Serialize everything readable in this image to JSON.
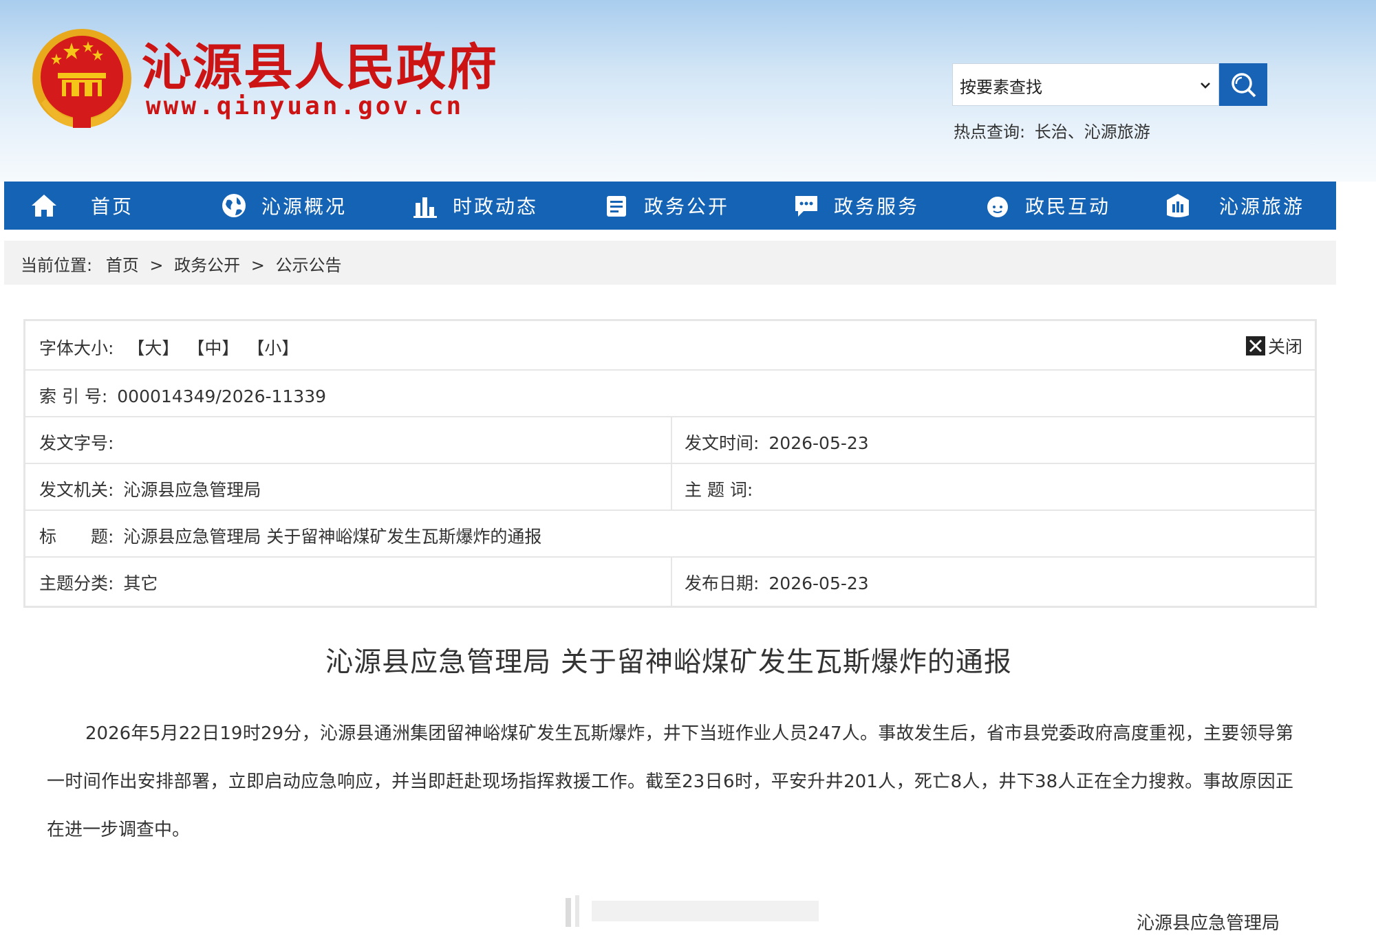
{
  "header": {
    "site_name": "沁源县人民政府",
    "site_url": "www.qinyuan.gov.cn",
    "search": {
      "selected": "按要素查找",
      "button_icon": "search-icon"
    },
    "hot_search": {
      "label": "热点查询:",
      "terms": "长治、沁源旅游"
    }
  },
  "nav": {
    "items": [
      {
        "label": "首页",
        "icon": "home-icon"
      },
      {
        "label": "沁源概况",
        "icon": "globe-icon"
      },
      {
        "label": "时政动态",
        "icon": "bar-chart-icon"
      },
      {
        "label": "政务公开",
        "icon": "document-icon"
      },
      {
        "label": "政务服务",
        "icon": "chat-icon"
      },
      {
        "label": "政民互动",
        "icon": "people-icon"
      },
      {
        "label": "沁源旅游",
        "icon": "building-icon"
      }
    ]
  },
  "breadcrumb": {
    "prefix": "当前位置:",
    "items": [
      "首页",
      "政务公开",
      "公示公告"
    ],
    "separator": ">"
  },
  "info_table": {
    "font_size": {
      "label": "字体大小:",
      "large": "【大】",
      "medium": "【中】",
      "small": "【小】"
    },
    "close_label": "关闭",
    "index_no": {
      "label": "索 引 号:",
      "value": "000014349/2026-11339"
    },
    "doc_no": {
      "label": "发文字号:",
      "value": ""
    },
    "issue_time": {
      "label": "发文时间:",
      "value": "2026-05-23"
    },
    "issuer": {
      "label": "发文机关:",
      "value": "沁源县应急管理局"
    },
    "topic_word": {
      "label": "主 题 词:",
      "value": ""
    },
    "title": {
      "label": "标　　题:",
      "value": "沁源县应急管理局 关于留神峪煤矿发生瓦斯爆炸的通报"
    },
    "category": {
      "label": "主题分类:",
      "value": "其它"
    },
    "publish_date": {
      "label": "发布日期:",
      "value": "2026-05-23"
    }
  },
  "article": {
    "title": "沁源县应急管理局 关于留神峪煤矿发生瓦斯爆炸的通报",
    "body": "2026年5月22日19时29分，沁源县通洲集团留神峪煤矿发生瓦斯爆炸，井下当班作业人员247人。事故发生后，省市县党委政府高度重视，主要领导第一时间作出安排部署，立即启动应急响应，并当即赶赴现场指挥救援工作。截至23日6时，平安升井201人，死亡8人，井下38人正在全力搜救。事故原因正在进一步调查中。",
    "signature": "沁源县应急管理局"
  },
  "colors": {
    "brand_red": "#cc1414",
    "nav_blue": "#1463b4",
    "search_blue": "#1863b6"
  }
}
